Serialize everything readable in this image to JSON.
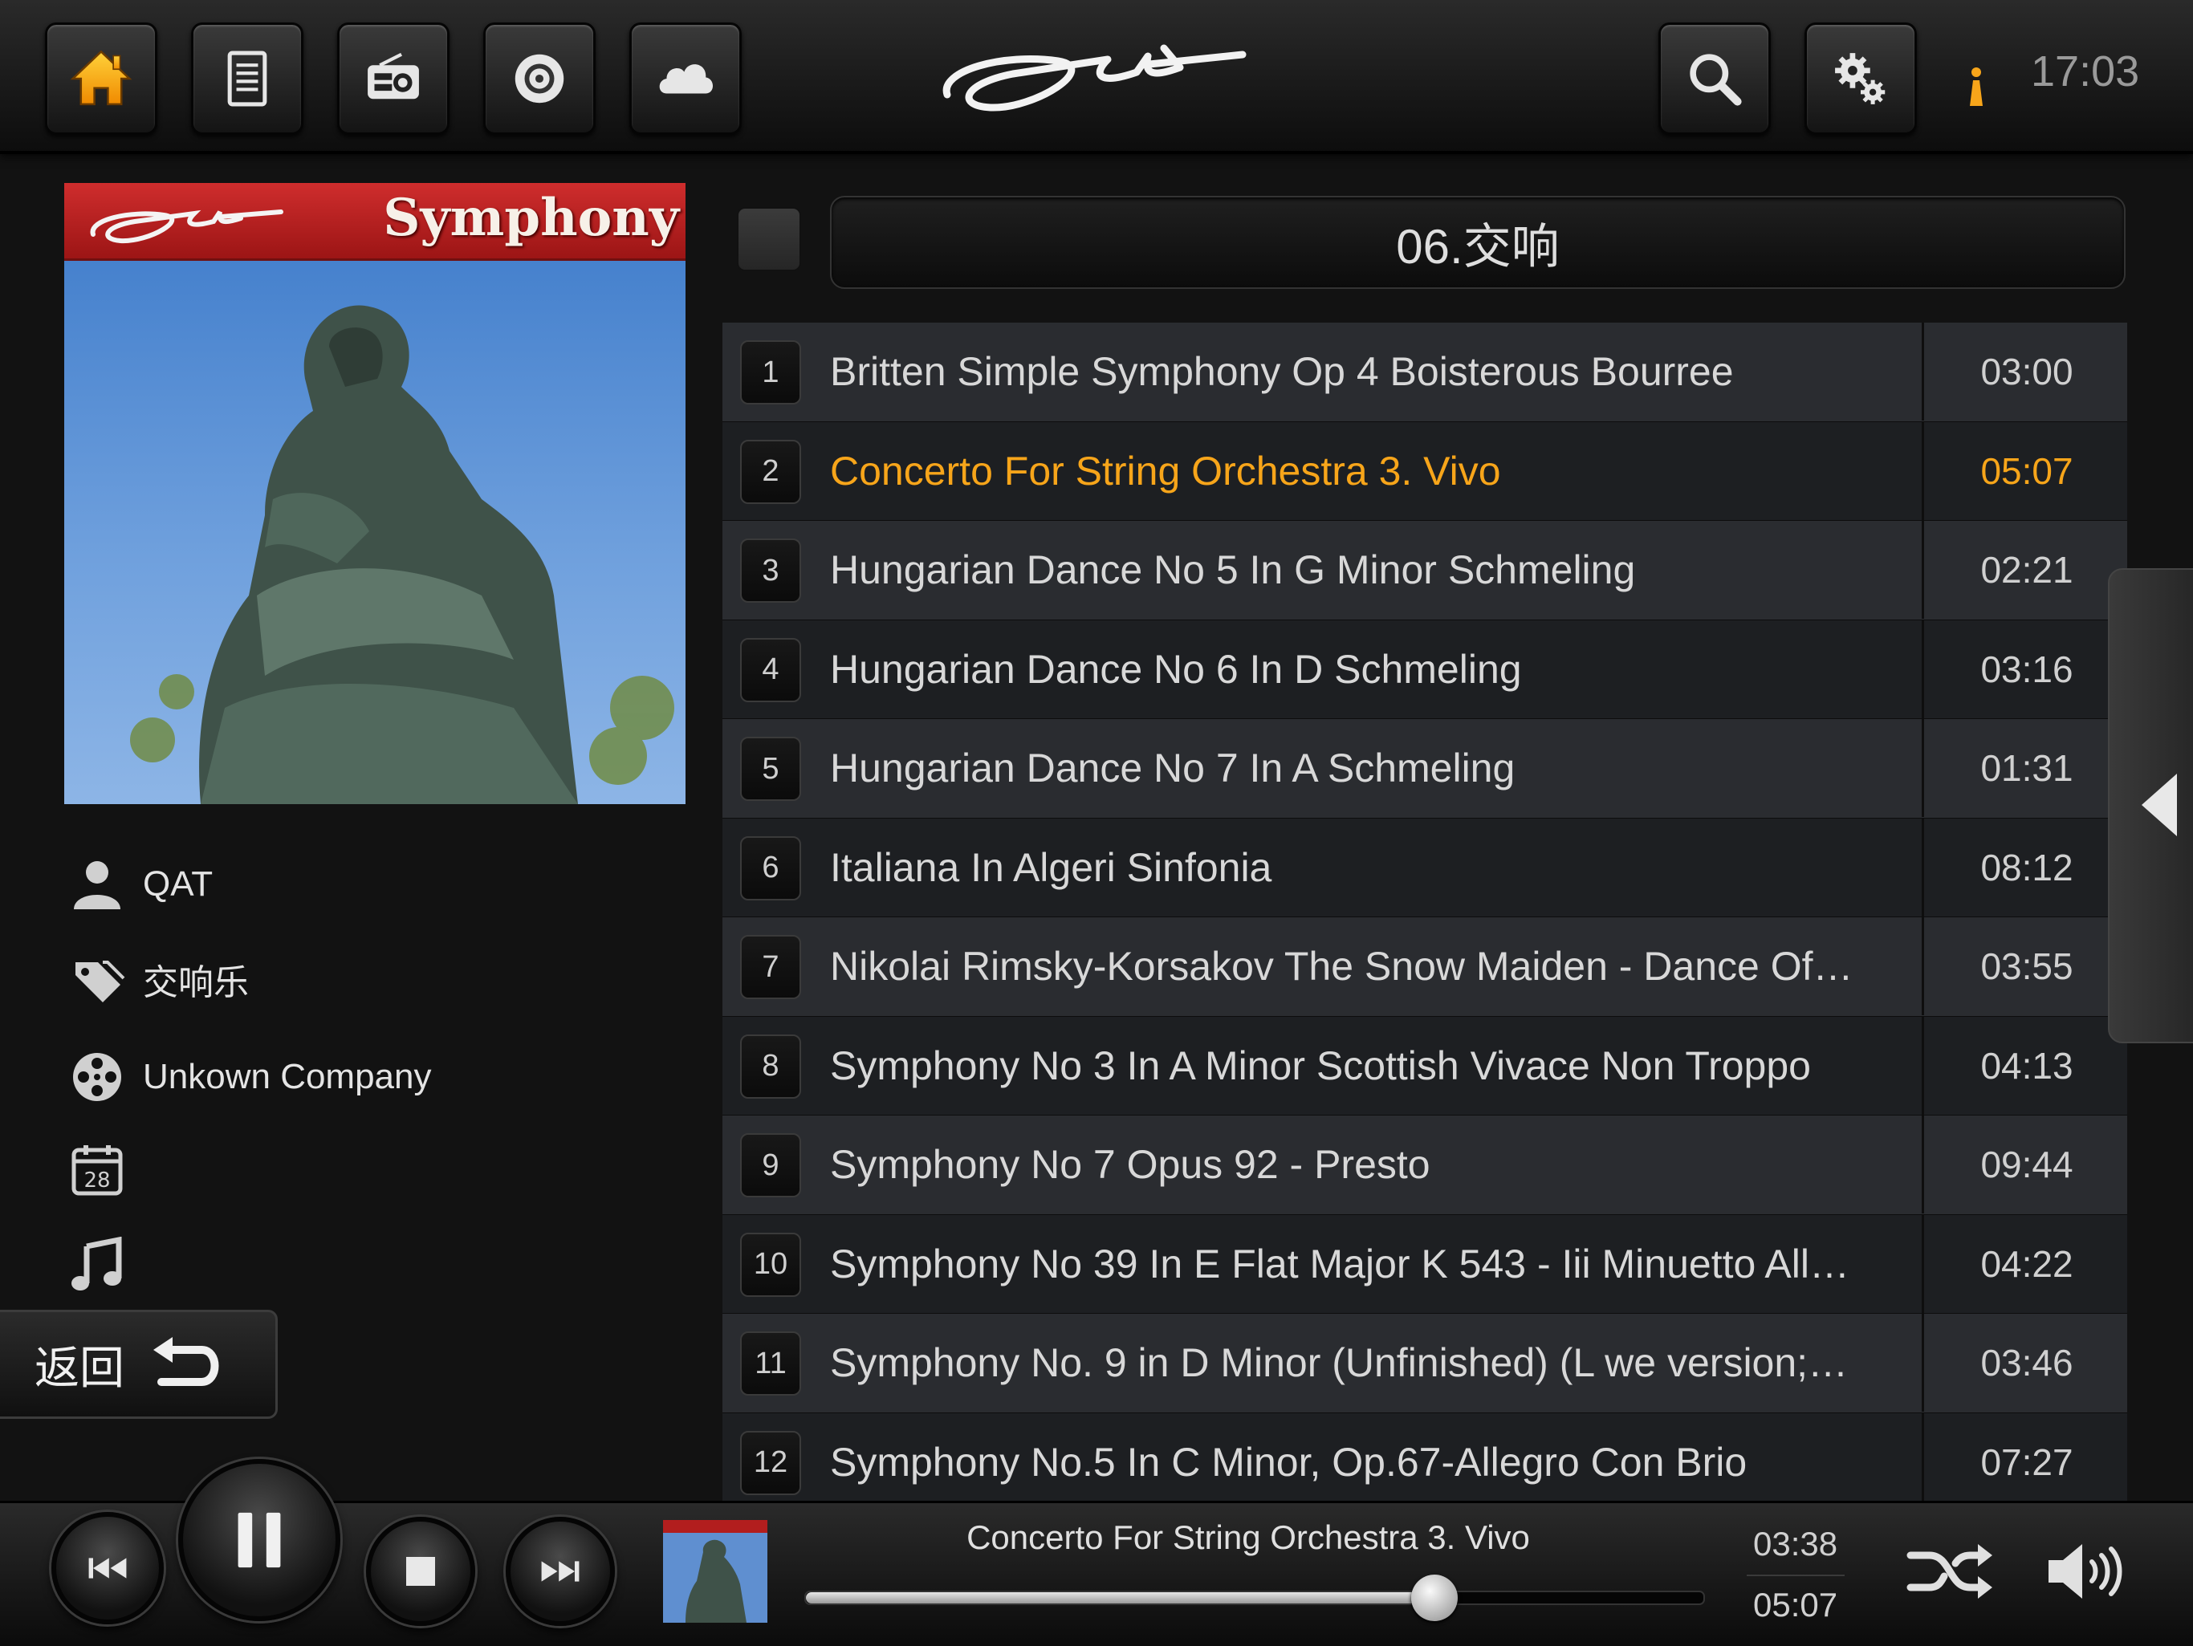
{
  "header": {
    "nav_icons": [
      "home-icon",
      "list-icon",
      "radio-icon",
      "cd-icon",
      "cloud-icon"
    ],
    "right_icons": [
      "search-icon",
      "settings-icon"
    ],
    "clock": "17:03",
    "accent": "#f7a51a"
  },
  "album": {
    "cover_title": "Symphony",
    "artist": "QAT",
    "genre": "交响乐",
    "label": "Unkown Company",
    "calendar_day": "28"
  },
  "back_button": {
    "label": "返回"
  },
  "playlist": {
    "title": "06.交响",
    "tracks": [
      {
        "no": "1",
        "title": "Britten Simple Symphony Op 4 Boisterous Bourree",
        "duration": "03:00"
      },
      {
        "no": "2",
        "title": "Concerto For String Orchestra 3. Vivo",
        "duration": "05:07"
      },
      {
        "no": "3",
        "title": "Hungarian Dance No 5 In G Minor Schmeling",
        "duration": "02:21"
      },
      {
        "no": "4",
        "title": "Hungarian Dance No 6 In D Schmeling",
        "duration": "03:16"
      },
      {
        "no": "5",
        "title": "Hungarian Dance No 7 In A Schmeling",
        "duration": "01:31"
      },
      {
        "no": "6",
        "title": "Italiana In Algeri  Sinfonia",
        "duration": "08:12"
      },
      {
        "no": "7",
        "title": "Nikolai Rimsky-Korsakov The Snow Maiden - Dance Of…",
        "duration": "03:55"
      },
      {
        "no": "8",
        "title": "Symphony No 3 In A Minor Scottish Vivace Non Troppo",
        "duration": "04:13"
      },
      {
        "no": "9",
        "title": "Symphony No 7 Opus 92 - Presto",
        "duration": "09:44"
      },
      {
        "no": "10",
        "title": "Symphony No 39 In E Flat Major K 543 - Iii Minuetto All…",
        "duration": "04:22"
      },
      {
        "no": "11",
        "title": "Symphony No. 9 in D Minor  (Unfinished) (L we version;…",
        "duration": "03:46"
      },
      {
        "no": "12",
        "title": "Symphony No.5 In C Minor, Op.67-Allegro Con Brio",
        "duration": "07:27"
      }
    ],
    "active_index": 1
  },
  "player": {
    "now_playing": "Concerto For String Orchestra 3. Vivo",
    "current_time": "03:38",
    "total_time": "05:07",
    "progress": 0.7,
    "state": "playing"
  }
}
